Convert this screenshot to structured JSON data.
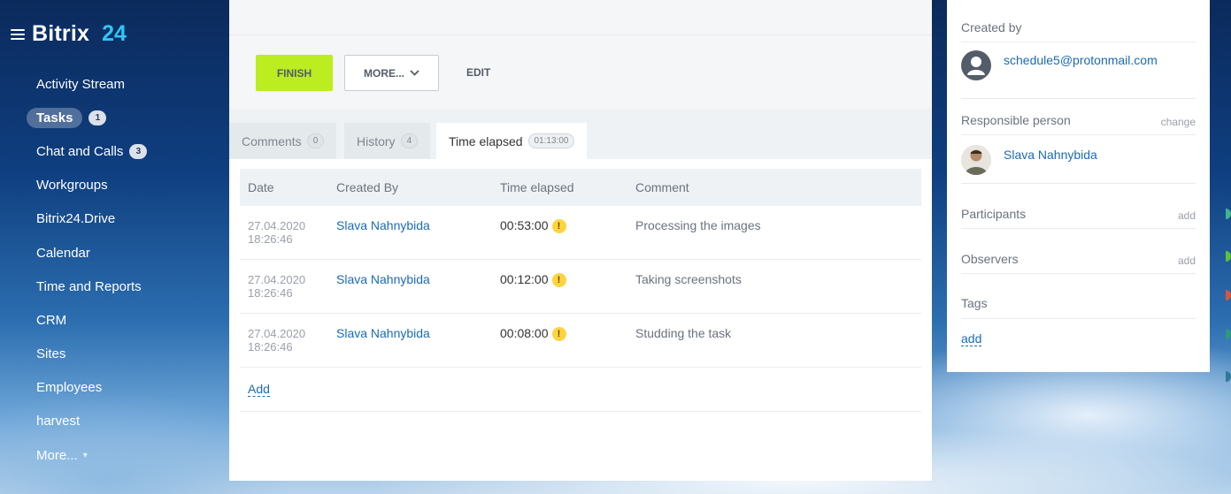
{
  "logo": {
    "name": "Bitrix",
    "number": "24"
  },
  "sidebar": {
    "items": [
      {
        "label": "Activity Stream"
      },
      {
        "label": "Tasks",
        "count": "1"
      },
      {
        "label": "Chat and Calls",
        "count": "3"
      },
      {
        "label": "Workgroups"
      },
      {
        "label": "Bitrix24.Drive"
      },
      {
        "label": "Calendar"
      },
      {
        "label": "Time and Reports"
      },
      {
        "label": "CRM"
      },
      {
        "label": "Sites"
      },
      {
        "label": "Employees"
      },
      {
        "label": "harvest"
      },
      {
        "label": "More..."
      }
    ],
    "active_item": "Tasks"
  },
  "toolbar": {
    "finish_label": "FINISH",
    "more_label": "MORE...",
    "edit_label": "EDIT"
  },
  "tabs": [
    {
      "label": "Comments",
      "count": "0"
    },
    {
      "label": "History",
      "count": "4"
    },
    {
      "label": "Time elapsed",
      "count": "01:13:00"
    }
  ],
  "active_tab": "Time elapsed",
  "table": {
    "headers": [
      "Date",
      "Created By",
      "Time elapsed",
      "Comment"
    ],
    "rows": [
      {
        "date": "27.04.2020",
        "time_of_day": "18:26:46",
        "created_by": "Slava Nahnybida",
        "elapsed": "00:53:00",
        "comment": "Processing the images"
      },
      {
        "date": "27.04.2020",
        "time_of_day": "18:26:46",
        "created_by": "Slava Nahnybida",
        "elapsed": "00:12:00",
        "comment": "Taking screenshots"
      },
      {
        "date": "27.04.2020",
        "time_of_day": "18:26:46",
        "created_by": "Slava Nahnybida",
        "elapsed": "00:08:00",
        "comment": "Studding the task"
      }
    ],
    "warning_glyph": "!",
    "add_label": "Add"
  },
  "right_panel": {
    "created_by_label": "Created by",
    "created_by_user": "schedule5@protonmail.com",
    "responsible_label": "Responsible person",
    "responsible_action": "change",
    "responsible_user": "Slava Nahnybida",
    "participants_label": "Participants",
    "participants_action": "add",
    "observers_label": "Observers",
    "observers_action": "add",
    "tags_label": "Tags",
    "tags_action": "add"
  },
  "colors": {
    "finish_button": "#bbed21",
    "link": "#1a6bb6",
    "logo_number": "#2fc6f6",
    "warning": "#fdd43f"
  }
}
